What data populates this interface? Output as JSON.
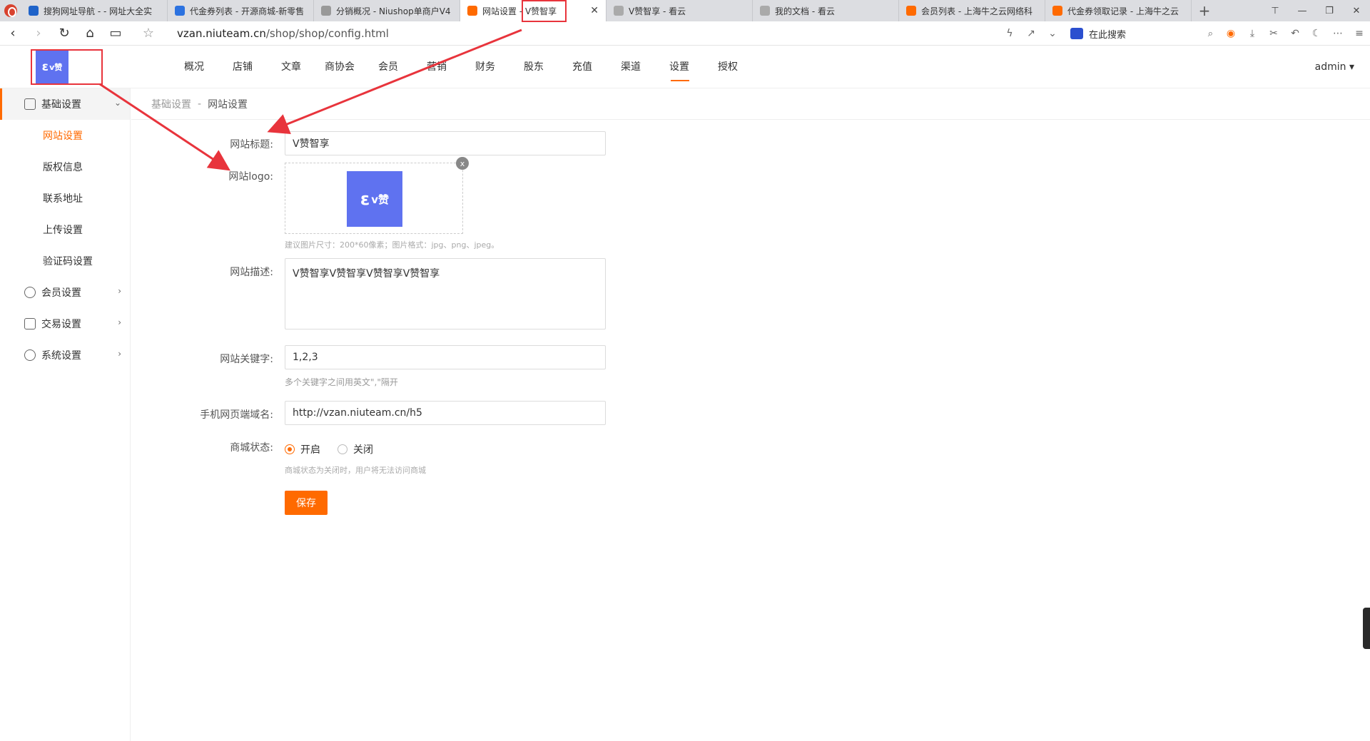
{
  "browser": {
    "tabs": [
      {
        "title": "搜狗网址导航 - - 网址大全实",
        "color": "#1f63c9",
        "active": false
      },
      {
        "title": "代金券列表 - 开源商城-新零售",
        "color": "#2c72e0",
        "active": false
      },
      {
        "title": "分销概况 - Niushop单商户V4",
        "color": "#888888",
        "active": false
      },
      {
        "title": "网站设置 - V赞智享",
        "color": "#ff6a00",
        "active": true
      },
      {
        "title": "V赞智享 - 看云",
        "color": "#888888",
        "active": false
      },
      {
        "title": "我的文档 - 看云",
        "color": "#888888",
        "active": false
      },
      {
        "title": "会员列表 - 上海牛之云网络科",
        "color": "#ff6a00",
        "active": false
      },
      {
        "title": "代金券领取记录 - 上海牛之云",
        "color": "#ff6a00",
        "active": false
      }
    ],
    "url_host": "vzan.niuteam.cn",
    "url_path": "/shop/shop/config.html",
    "search_label": "在此搜索"
  },
  "header": {
    "logo_text": "ε",
    "logo_sub": "v赞",
    "nav": [
      "概况",
      "店铺",
      "文章",
      "商协会",
      "会员",
      "营销",
      "财务",
      "股东",
      "充值",
      "渠道",
      "设置",
      "授权"
    ],
    "active_nav": "设置",
    "user": "admin ▾"
  },
  "sidebar": {
    "basic": {
      "label": "基础设置",
      "items": [
        "网站设置",
        "版权信息",
        "联系地址",
        "上传设置",
        "验证码设置"
      ]
    },
    "groups": [
      "会员设置",
      "交易设置",
      "系统设置"
    ]
  },
  "breadcrumb": {
    "parent": "基础设置",
    "sep": "-",
    "current": "网站设置"
  },
  "form": {
    "title_label": "网站标题:",
    "title_value": "V赞智享",
    "logo_label": "网站logo:",
    "logo_hint": "建议图片尺寸：200*60像素；图片格式：jpg、png、jpeg。",
    "desc_label": "网站描述:",
    "desc_value": "V赞智享V赞智享V赞智享V赞智享",
    "keywords_label": "网站关键字:",
    "keywords_value": "1,2,3",
    "keywords_hint": "多个关键字之间用英文\",\"隔开",
    "domain_label": "手机网页端域名:",
    "domain_value": "http://vzan.niuteam.cn/h5",
    "status_label": "商城状态:",
    "status_on": "开启",
    "status_off": "关闭",
    "status_hint": "商城状态为关闭时，用户将无法访问商城",
    "save": "保存"
  },
  "colors": {
    "accent": "#ff6a00",
    "logo_bg": "#5f72f0",
    "annotation": "#e8343c"
  }
}
